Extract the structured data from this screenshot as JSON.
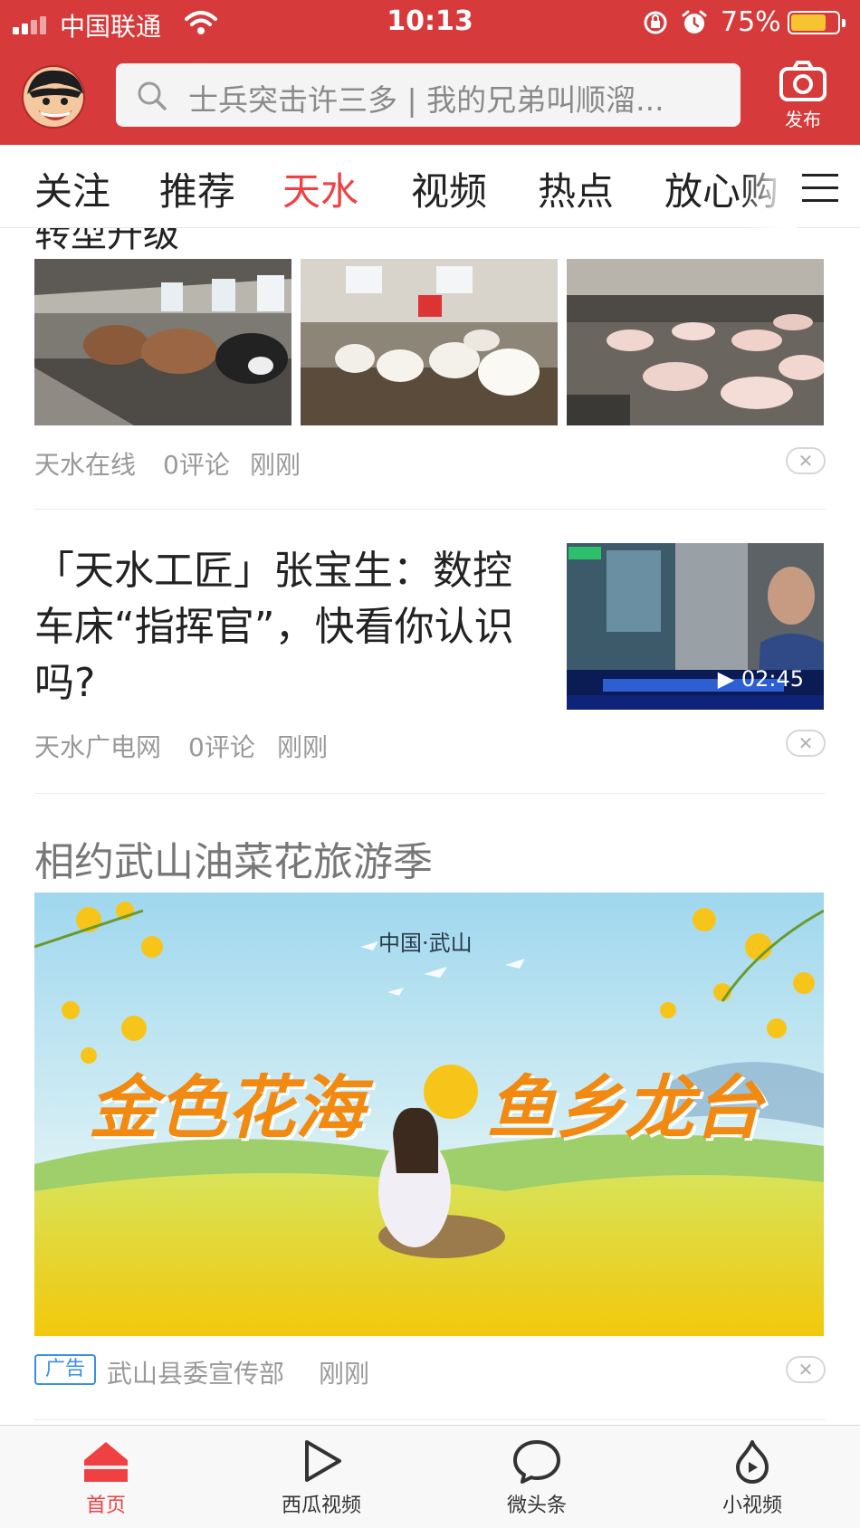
{
  "status_bar": {
    "carrier": "中国联通",
    "time": "10:13",
    "battery_percent": "75%",
    "battery_level": 0.75
  },
  "header": {
    "search_placeholder": "士兵突击许三多 | 我的兄弟叫顺溜...",
    "publish_label": "发布"
  },
  "tabs": [
    {
      "label": "关注",
      "active": false
    },
    {
      "label": "推荐",
      "active": false
    },
    {
      "label": "天水",
      "active": true
    },
    {
      "label": "视频",
      "active": false
    },
    {
      "label": "热点",
      "active": false
    },
    {
      "label": "放心购",
      "active": false
    }
  ],
  "feed": {
    "item1": {
      "title_partial": "转型升级",
      "source": "天水在线",
      "comments": "0评论",
      "time": "刚刚"
    },
    "item2": {
      "title": "「天水工匠」张宝生：数控车床“指挥官”，快看你认识吗?",
      "video_duration": "02:45",
      "source": "天水广电网",
      "comments": "0评论",
      "time": "刚刚"
    },
    "item3": {
      "title": "相约武山油菜花旅游季",
      "banner_small": "中国·武山",
      "banner_left": "金色花海",
      "banner_right": "鱼乡龙台",
      "ad_tag": "广告",
      "source": "武山县委宣传部",
      "time": "刚刚"
    },
    "close_glyph": "✕"
  },
  "bottom_nav": [
    {
      "label": "首页",
      "icon": "home-icon",
      "active": true
    },
    {
      "label": "西瓜视频",
      "icon": "play-icon",
      "active": false
    },
    {
      "label": "微头条",
      "icon": "chat-bubble-icon",
      "active": false
    },
    {
      "label": "小视频",
      "icon": "flame-play-icon",
      "active": false
    }
  ],
  "colors": {
    "brand_red": "#d63a3a",
    "active_red": "#f04142",
    "ad_blue": "#3a8ee6",
    "battery_yellow": "#f6c431"
  }
}
